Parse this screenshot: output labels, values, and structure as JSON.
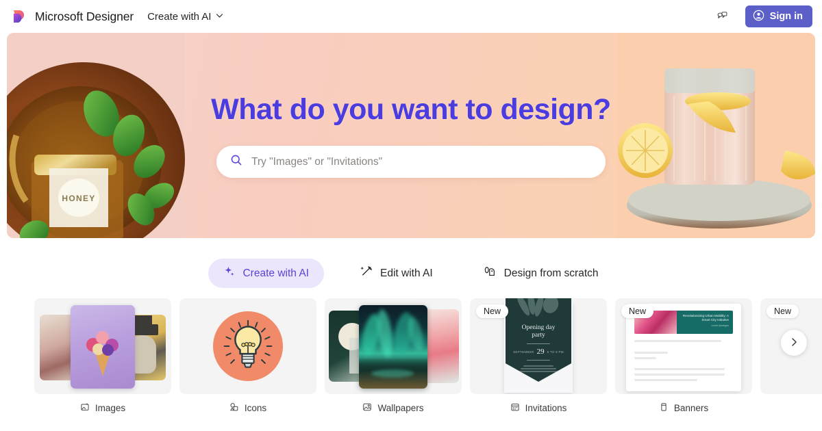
{
  "topbar": {
    "brand_name": "Microsoft Designer",
    "nav_dropdown_label": "Create with AI",
    "feedback_icon": "feedback-chat-icon",
    "signin_label": "Sign in",
    "signin_icon": "person-circle-icon",
    "accent_color": "#5b5fc7"
  },
  "hero": {
    "title": "What do you want to design?",
    "title_color": "#4b3ce0",
    "search_placeholder": "Try \"Images\" or \"Invitations\"",
    "search_icon": "search-icon",
    "gradient_from": "#f7d4cb",
    "gradient_to": "#fbcfae",
    "left_image_alt": "HONEY",
    "right_image_alt": "lemon water glass"
  },
  "tabs": [
    {
      "label": "Create with AI",
      "icon": "sparkle-icon",
      "active": true
    },
    {
      "label": "Edit with AI",
      "icon": "magic-wand-icon",
      "active": false
    },
    {
      "label": "Design from scratch",
      "icon": "shapes-icon",
      "active": false
    }
  ],
  "cards": [
    {
      "label": "Images",
      "icon": "image-sparkle-icon",
      "badge": ""
    },
    {
      "label": "Icons",
      "icon": "icons-icon",
      "badge": ""
    },
    {
      "label": "Wallpapers",
      "icon": "wallpaper-icon",
      "badge": ""
    },
    {
      "label": "Invitations",
      "icon": "calendar-icon",
      "badge": "New"
    },
    {
      "label": "Banners",
      "icon": "banner-icon",
      "badge": "New"
    },
    {
      "label": "",
      "icon": "",
      "badge": "New"
    }
  ],
  "card_art": {
    "invitation": {
      "title": "Opening day",
      "title2": "party",
      "day": "29"
    },
    "banner": {
      "headline": "Revolutionizing Urban Mobility: A Smart City Initiative",
      "sub": "Lorem Ipsumgen"
    }
  },
  "carousel": {
    "next_label": "",
    "next_icon": "chevron-right-icon"
  }
}
